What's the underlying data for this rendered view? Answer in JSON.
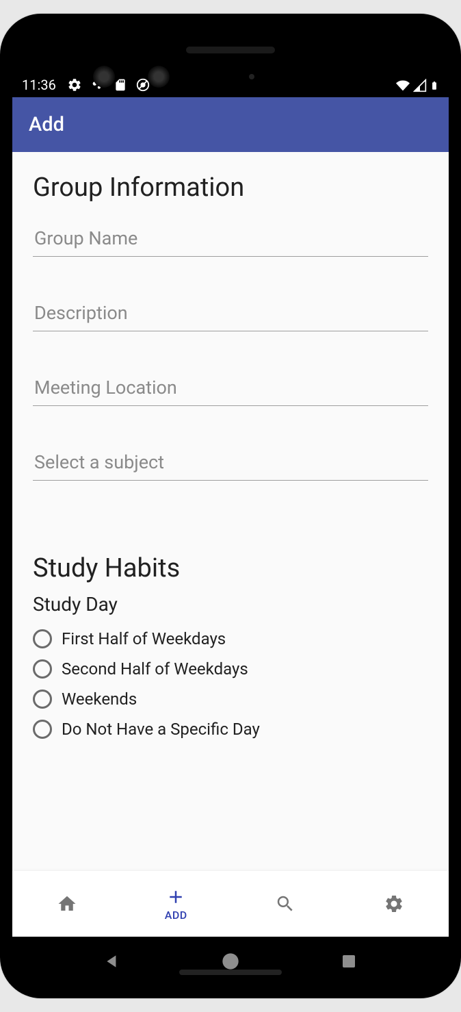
{
  "status": {
    "time": "11:36"
  },
  "appbar": {
    "title": "Add"
  },
  "form": {
    "section1_heading": "Group Information",
    "group_name_placeholder": "Group Name",
    "description_placeholder": "Description",
    "location_placeholder": "Meeting Location",
    "subject_placeholder": "Select a subject",
    "section2_heading": "Study Habits",
    "study_day_label": "Study Day",
    "radio_options": [
      "First Half of Weekdays",
      "Second Half of Weekdays",
      "Weekends",
      "Do Not Have a Specific Day"
    ]
  },
  "bottomnav": {
    "add_label": "ADD"
  }
}
